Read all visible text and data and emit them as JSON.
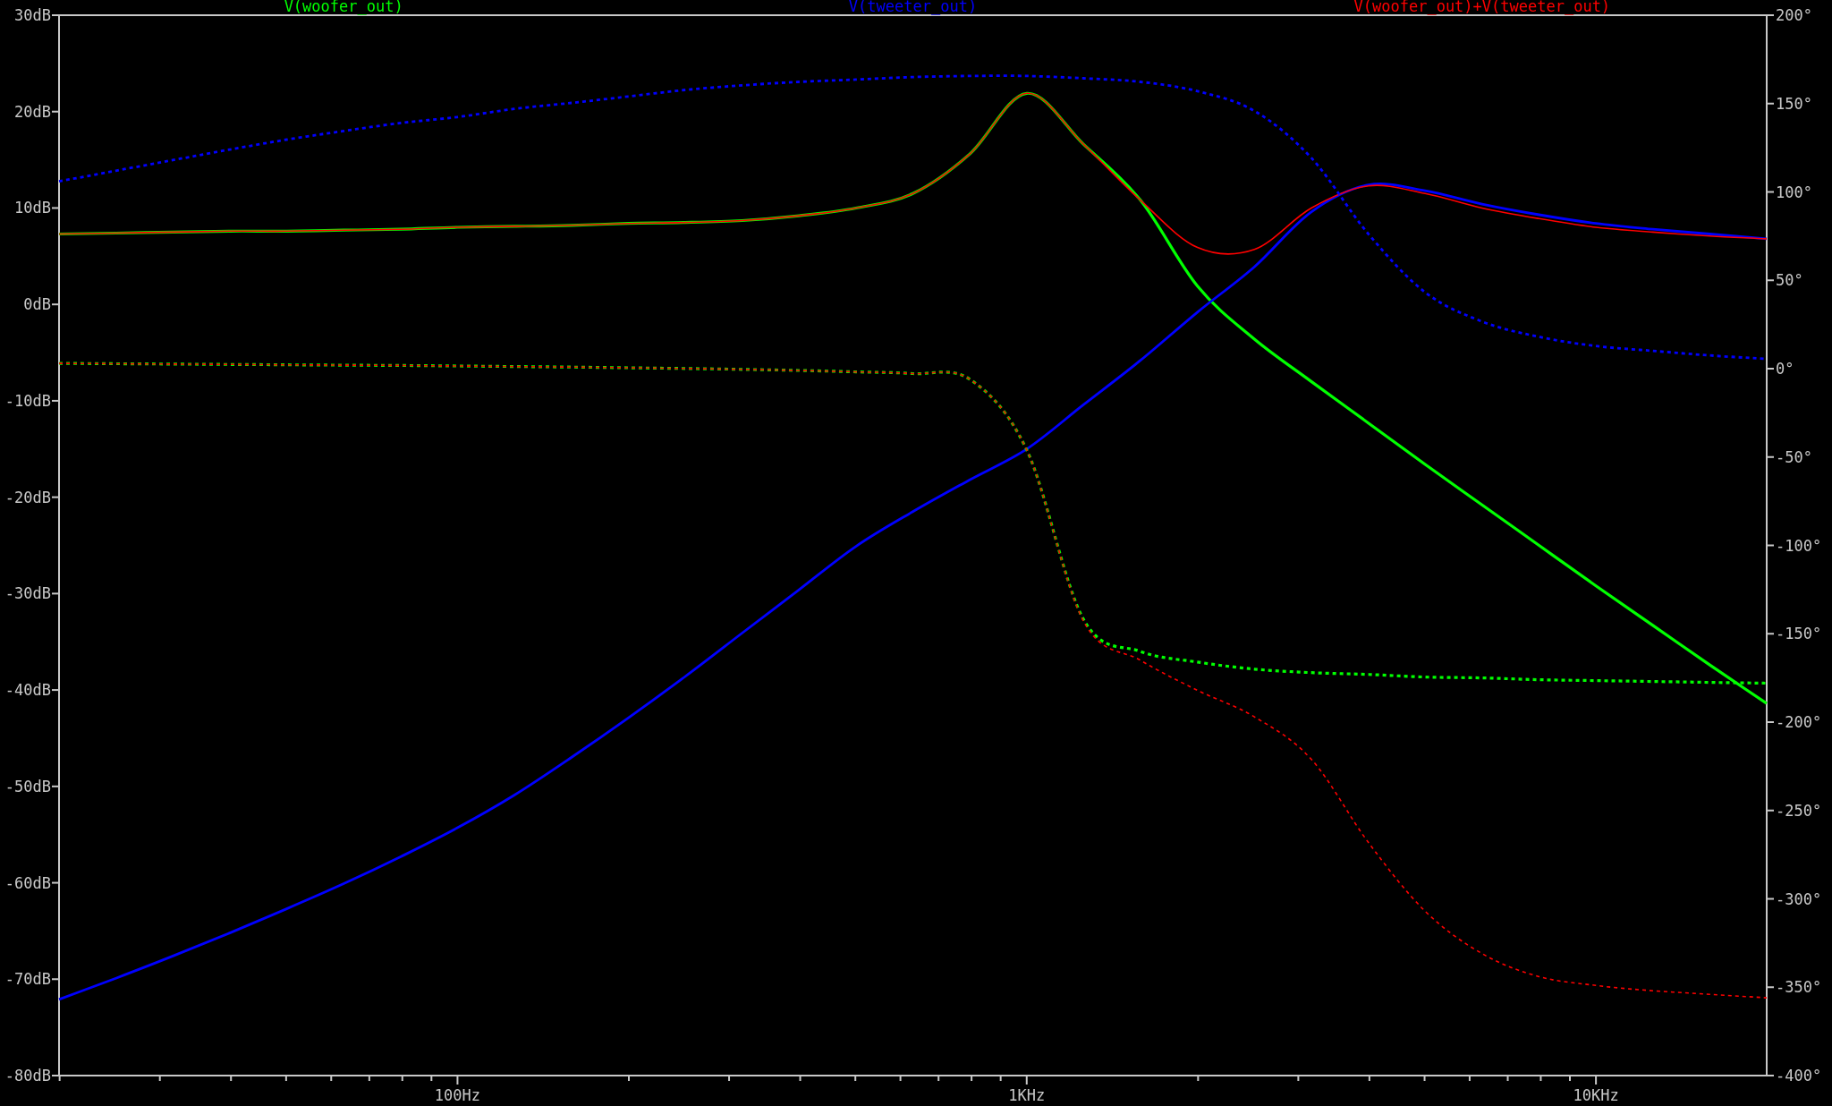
{
  "magnitude_plot": {
    "chart_data": {
      "type": "line",
      "categories": [
        null,
        null,
        null,
        null,
        null,
        null,
        null,
        "100Hz",
        null,
        null,
        null,
        null,
        null,
        null,
        null,
        null,
        null,
        "1KHz",
        null,
        null,
        null,
        null,
        null,
        null,
        null,
        null,
        null,
        "10KHz",
        null,
        null,
        null
      ],
      "ylim": [
        -80,
        30
      ],
      "yticks": [
        {
          "value": 30,
          "label": "30dB"
        },
        {
          "value": 20,
          "label": "20dB"
        },
        {
          "value": 10,
          "label": "10dB"
        },
        {
          "value": 0,
          "label": "0dB"
        },
        {
          "value": -10,
          "label": "-10dB"
        },
        {
          "value": -20,
          "label": "-20dB"
        },
        {
          "value": -30,
          "label": "-30dB"
        },
        {
          "value": -40,
          "label": "-40dB"
        },
        {
          "value": -50,
          "label": "-50dB"
        },
        {
          "value": -60,
          "label": "-60dB"
        },
        {
          "value": -70,
          "label": "-70dB"
        },
        {
          "value": -80,
          "label": "-80dB"
        }
      ],
      "series": [
        {
          "name": "V(woofer_out)",
          "color": "#00ff00",
          "values": [
            7.3,
            7.4,
            7.5,
            7.6,
            7.6,
            7.7,
            7.8,
            8.0,
            8.1,
            8.2,
            8.4,
            8.5,
            8.7,
            9.2,
            10.0,
            11.5,
            15.6,
            21.9,
            16.6,
            10.8,
            1.9,
            -3.6,
            -8.0,
            -12.3,
            -16.6,
            -20.8,
            -25.0,
            -29.2,
            -33.3,
            -37.4,
            -41.4
          ]
        },
        {
          "name": "V(tweeter_out)",
          "color": "#0000ff",
          "values": [
            -72.1,
            -69.9,
            -67.6,
            -65.2,
            -62.7,
            -60.1,
            -57.3,
            -54.3,
            -50.9,
            -47.0,
            -42.9,
            -38.6,
            -34.1,
            -29.6,
            -25.1,
            -21.5,
            -18.2,
            -15.0,
            -10.4,
            -5.8,
            -0.8,
            3.9,
            9.6,
            12.4,
            11.8,
            10.4,
            9.3,
            8.4,
            7.8,
            7.3,
            6.8
          ]
        },
        {
          "name": "V(woofer_out)+V(tweeter_out)",
          "color": "#ff0000",
          "values": [
            7.3,
            7.4,
            7.5,
            7.6,
            7.6,
            7.7,
            7.8,
            8.0,
            8.1,
            8.2,
            8.4,
            8.5,
            8.7,
            9.2,
            10.0,
            11.5,
            15.6,
            21.9,
            16.6,
            10.8,
            5.9,
            5.7,
            10.0,
            12.3,
            11.5,
            10.0,
            8.9,
            8.0,
            7.5,
            7.1,
            6.8
          ]
        }
      ]
    }
  },
  "phase_plot": {
    "chart_data": {
      "type": "line",
      "ylim": [
        -400,
        200
      ],
      "yticks": [
        {
          "value": 200,
          "label": "200°"
        },
        {
          "value": 150,
          "label": "150°"
        },
        {
          "value": 100,
          "label": "100°"
        },
        {
          "value": 50,
          "label": "50°"
        },
        {
          "value": 0,
          "label": "0°"
        },
        {
          "value": -50,
          "label": "-50°"
        },
        {
          "value": -100,
          "label": "-100°"
        },
        {
          "value": -150,
          "label": "-150°"
        },
        {
          "value": -200,
          "label": "-200°"
        },
        {
          "value": -250,
          "label": "-250°"
        },
        {
          "value": -300,
          "label": "-300°"
        },
        {
          "value": -350,
          "label": "-350°"
        },
        {
          "value": -400,
          "label": "-400°"
        }
      ],
      "series": [
        {
          "color": "#00ff00",
          "line_style": "dashed",
          "values": [
            3,
            2.8,
            2.6,
            2.4,
            2.2,
            2.0,
            1.8,
            1.5,
            1.2,
            0.9,
            0.5,
            0.1,
            -0.4,
            -1.0,
            -1.8,
            -2.8,
            -6,
            -46,
            -142,
            -160,
            -166,
            -170,
            -172,
            -173,
            -174.5,
            -175,
            -176,
            -176.5,
            -177,
            -177.5,
            -178
          ]
        },
        {
          "color": "#0000ff",
          "line_style": "dashed",
          "values": [
            106,
            112,
            118,
            124,
            129.6,
            134.5,
            139,
            142.4,
            147,
            150.4,
            154,
            157.7,
            160.3,
            162.3,
            163.6,
            165,
            165.6,
            165.6,
            164.3,
            162.3,
            157,
            145.8,
            119.3,
            76.3,
            43.2,
            26.7,
            18,
            12.8,
            10.1,
            7.5,
            5.5
          ]
        },
        {
          "color": "#ff0000",
          "line_style": "dashed",
          "values": [
            3,
            2.8,
            2.6,
            2.4,
            2.2,
            2.0,
            1.8,
            1.5,
            1.2,
            0.9,
            0.5,
            0.1,
            -0.4,
            -1.0,
            -1.8,
            -2.8,
            -6,
            -46,
            -143,
            -165,
            -182,
            -197,
            -221,
            -268,
            -307,
            -331,
            -344,
            -349,
            -352,
            -354,
            -356
          ]
        }
      ]
    }
  }
}
